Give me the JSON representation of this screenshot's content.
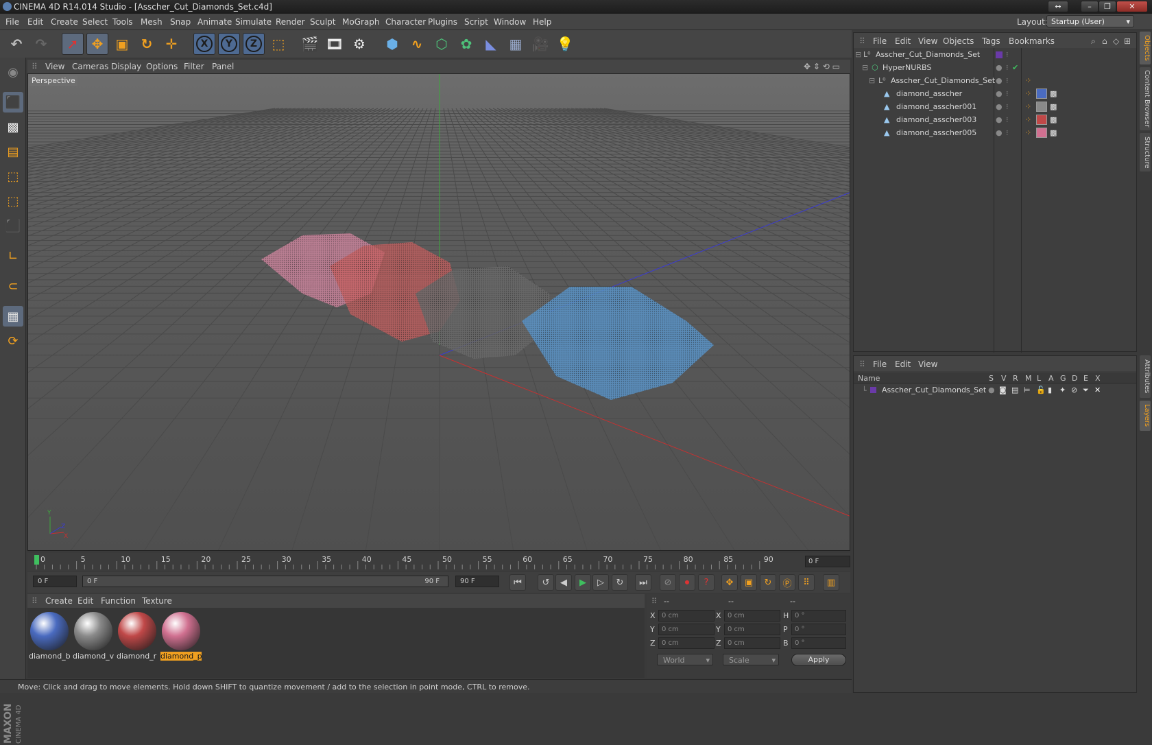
{
  "window": {
    "title": "CINEMA 4D R14.014 Studio - [Asscher_Cut_Diamonds_Set.c4d]",
    "buttons": [
      "↔",
      "–",
      "❐",
      "✕"
    ]
  },
  "menubar": {
    "items": [
      "File",
      "Edit",
      "Create",
      "Select",
      "Tools",
      "Mesh",
      "Snap",
      "Animate",
      "Simulate",
      "Render",
      "Sculpt",
      "MoGraph",
      "Character",
      "Plugins",
      "Script",
      "Window",
      "Help"
    ],
    "layout_label": "Layout:",
    "layout_value": "Startup (User)"
  },
  "viewport": {
    "menu": [
      "View",
      "Cameras",
      "Display",
      "Options",
      "Filter",
      "Panel"
    ],
    "label": "Perspective"
  },
  "timeline": {
    "ticks": [
      "0",
      "5",
      "10",
      "15",
      "20",
      "25",
      "30",
      "35",
      "40",
      "45",
      "50",
      "55",
      "60",
      "65",
      "70",
      "75",
      "80",
      "85",
      "90"
    ],
    "current_frame": "0 F",
    "start_field": "0 F",
    "range_start": "0 F",
    "range_end": "90 F",
    "end_field": "90 F"
  },
  "materials": {
    "menu": [
      "Create",
      "Edit",
      "Function",
      "Texture"
    ],
    "items": [
      {
        "label": "diamond_b",
        "color": "#4a6bc0"
      },
      {
        "label": "diamond_v",
        "color": "#8a8a8a"
      },
      {
        "label": "diamond_r",
        "color": "#c04848"
      },
      {
        "label": "diamond_p",
        "color": "#d07090"
      }
    ]
  },
  "coordinates": {
    "headers": [
      "--",
      "--",
      "--"
    ],
    "rows": [
      {
        "a": "X",
        "av": "0 cm",
        "b": "X",
        "bv": "0 cm",
        "c": "H",
        "cv": "0 °"
      },
      {
        "a": "Y",
        "av": "0 cm",
        "b": "Y",
        "bv": "0 cm",
        "c": "P",
        "cv": "0 °"
      },
      {
        "a": "Z",
        "av": "0 cm",
        "b": "Z",
        "bv": "0 cm",
        "c": "B",
        "cv": "0 °"
      }
    ],
    "mode": "World",
    "type": "Scale",
    "apply": "Apply"
  },
  "status": "Move: Click and drag to move elements. Hold down SHIFT to quantize movement / add to the selection in point mode, CTRL to remove.",
  "objects": {
    "menu": [
      "File",
      "Edit",
      "View",
      "Objects",
      "Tags",
      "Bookmarks"
    ],
    "items": [
      {
        "name": "Asscher_Cut_Diamonds_Set"
      },
      {
        "name": "HyperNURBS"
      },
      {
        "name": "Asscher_Cut_Diamonds_Set"
      },
      {
        "name": "diamond_asscher"
      },
      {
        "name": "diamond_asscher001"
      },
      {
        "name": "diamond_asscher003"
      },
      {
        "name": "diamond_asscher005"
      }
    ]
  },
  "layers": {
    "menu": [
      "File",
      "Edit",
      "View"
    ],
    "columns": [
      "Name",
      "S",
      "V",
      "R",
      "M",
      "L",
      "A",
      "G",
      "D",
      "E",
      "X"
    ],
    "row_name": "Asscher_Cut_Diamonds_Set"
  },
  "right_tabs": [
    "Objects",
    "Content Browser",
    "Structure",
    "Attributes",
    "Layers"
  ],
  "colors": {
    "accent": "#f0a020",
    "selection": "#5d6a7d"
  }
}
